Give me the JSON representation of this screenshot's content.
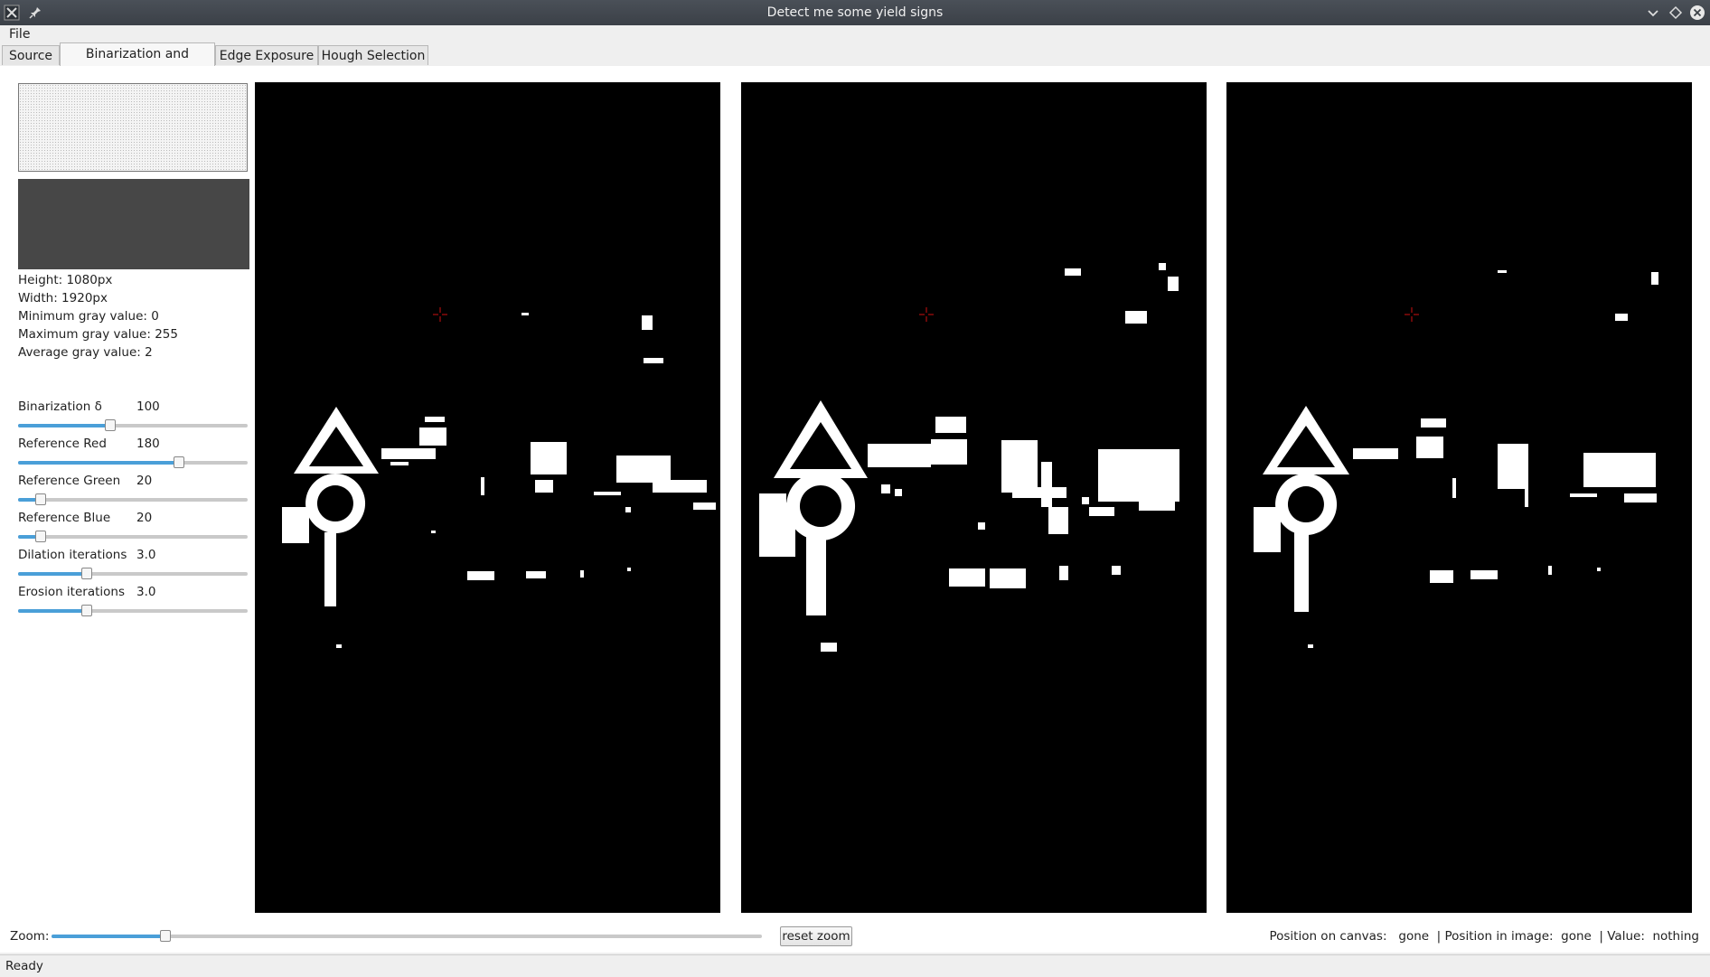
{
  "window": {
    "title": "Detect me some yield signs"
  },
  "menu": {
    "file": "File"
  },
  "tabs": [
    {
      "label": "Source",
      "active": false
    },
    {
      "label": "Binarization and Dilation",
      "active": true
    },
    {
      "label": "Edge Exposure",
      "active": false
    },
    {
      "label": "Hough Selection",
      "active": false
    }
  ],
  "image_info": {
    "height": "Height: 1080px",
    "width": "Width: 1920px",
    "min_gray": "Minimum gray value: 0",
    "max_gray": "Maximum gray value: 255",
    "avg_gray": "Average gray value: 2"
  },
  "sliders": [
    {
      "label": "Binarization δ",
      "value": "100",
      "fraction": 0.4
    },
    {
      "label": "Reference Red",
      "value": "180",
      "fraction": 0.7
    },
    {
      "label": "Reference Green",
      "value": "20",
      "fraction": 0.1
    },
    {
      "label": "Reference Blue",
      "value": "20",
      "fraction": 0.1
    },
    {
      "label": "Dilation iterations",
      "value": "3.0",
      "fraction": 0.3
    },
    {
      "label": "Erosion iterations",
      "value": "3.0",
      "fraction": 0.3
    }
  ],
  "zoom": {
    "label": "Zoom:",
    "fraction": 0.16,
    "reset_label": "reset zoom"
  },
  "position": {
    "text": "Position on canvas:   gone  | Position in image:  gone  | Value:  nothing"
  },
  "status": "Ready",
  "colors": {
    "accent": "#4a9fd8",
    "crosshair": "#cc1111",
    "panel_bg": "#000000",
    "titlebar": "#41464d"
  },
  "icons": [
    "app-icon",
    "pin-icon",
    "minimize-chevron-icon",
    "maximize-diamond-icon",
    "close-circle-icon"
  ]
}
